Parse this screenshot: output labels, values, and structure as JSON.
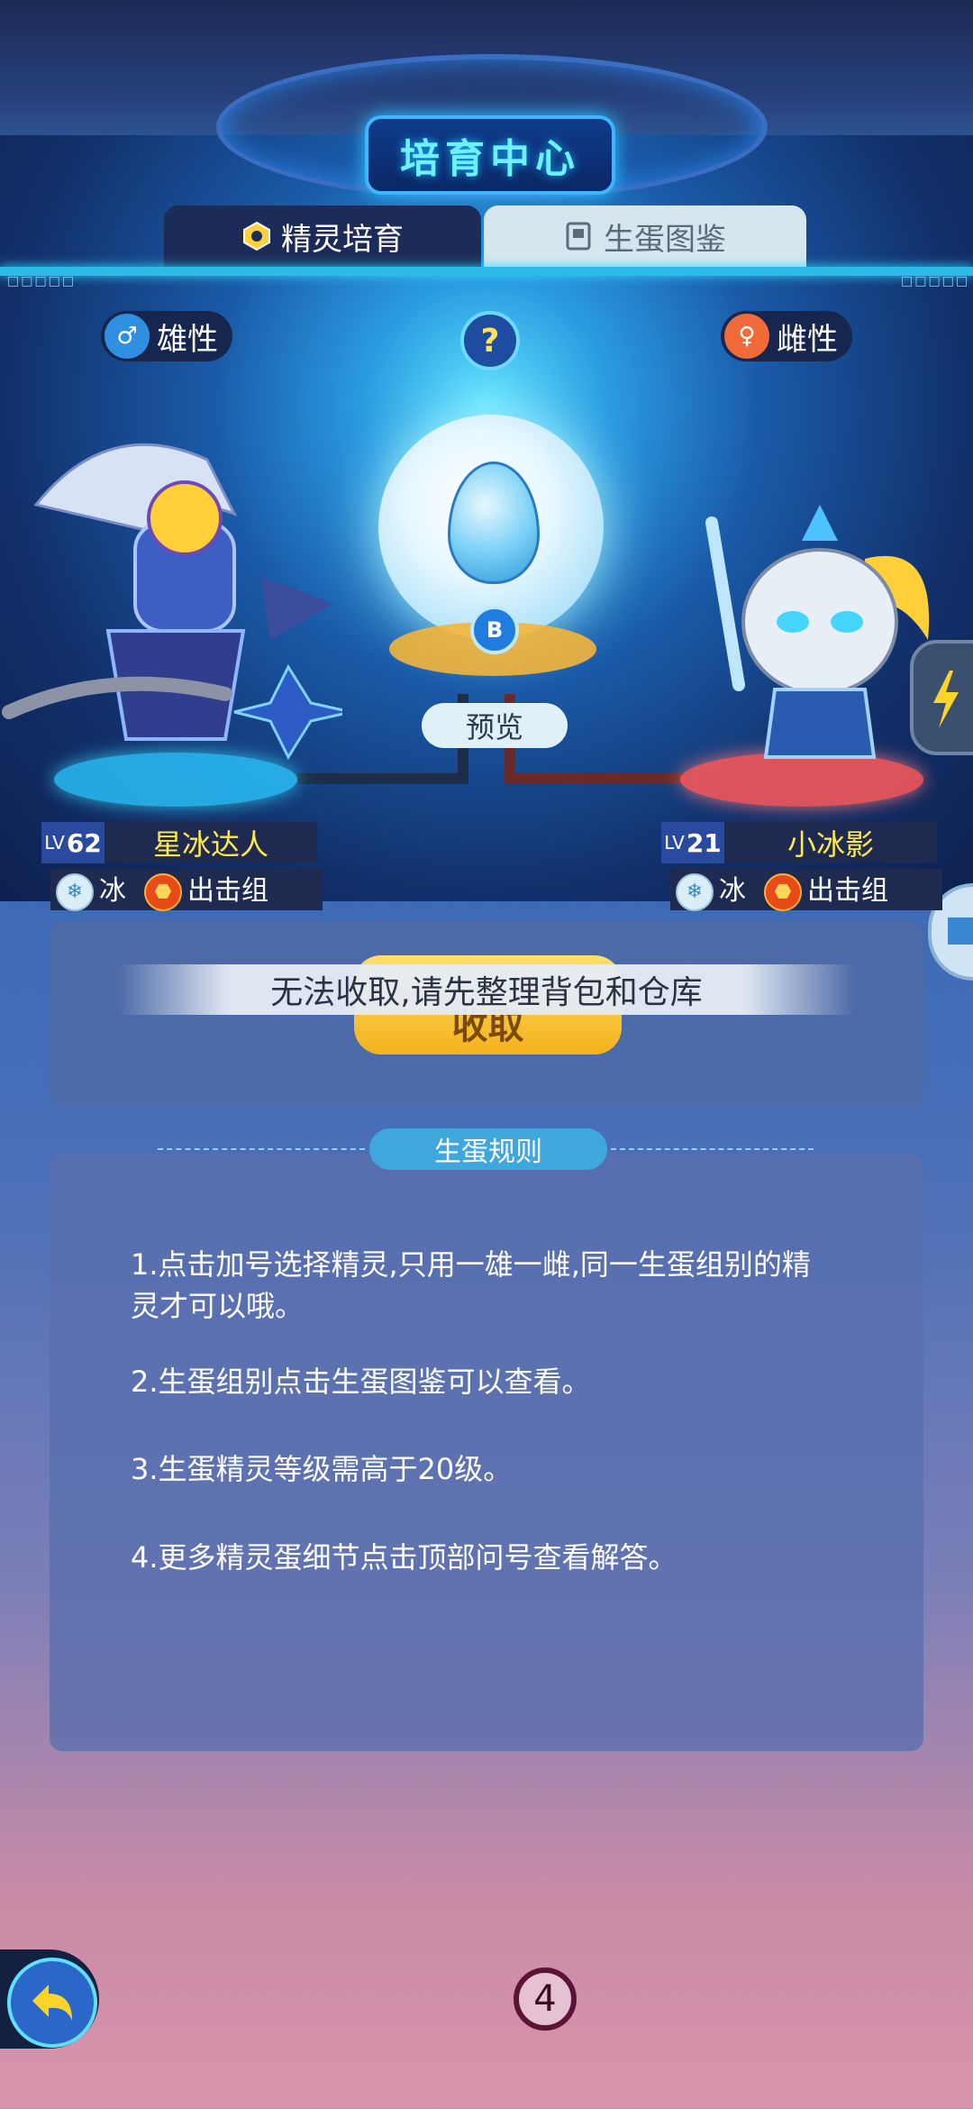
{
  "header": {
    "title": "培育中心"
  },
  "tabs": [
    {
      "label": "精灵培育",
      "active": true,
      "icon": "hexagon-icon"
    },
    {
      "label": "生蛋图鉴",
      "active": false,
      "icon": "book-icon"
    }
  ],
  "parents": {
    "male": {
      "gender_label": "雄性",
      "level_prefix": "LV",
      "level": "62",
      "name": "星冰达人",
      "element": "冰",
      "group": "出击组"
    },
    "female": {
      "gender_label": "雌性",
      "level_prefix": "LV",
      "level": "21",
      "name": "小冰影",
      "element": "冰",
      "group": "出击组"
    }
  },
  "egg": {
    "badge": "B",
    "preview_label": "预览"
  },
  "help": {
    "label": "?"
  },
  "collect": {
    "button_label": "收取",
    "toast": "无法收取,请先整理背包和仓库"
  },
  "rules": {
    "title": "生蛋规则",
    "items": [
      "1.点击加号选择精灵,只用一雄一雌,同一生蛋组别的精灵才可以哦。",
      "2.生蛋组别点击生蛋图鉴可以查看。",
      "3.生蛋精灵等级需高于20级。",
      "4.更多精灵蛋细节点击顶部问号查看解答。"
    ]
  },
  "footer": {
    "page_indicator": "4"
  },
  "colors": {
    "accent": "#3fa7dc",
    "name_yellow": "#ffe94a",
    "male_pad": "#2bc7ff",
    "female_pad": "#ff5a5a"
  }
}
